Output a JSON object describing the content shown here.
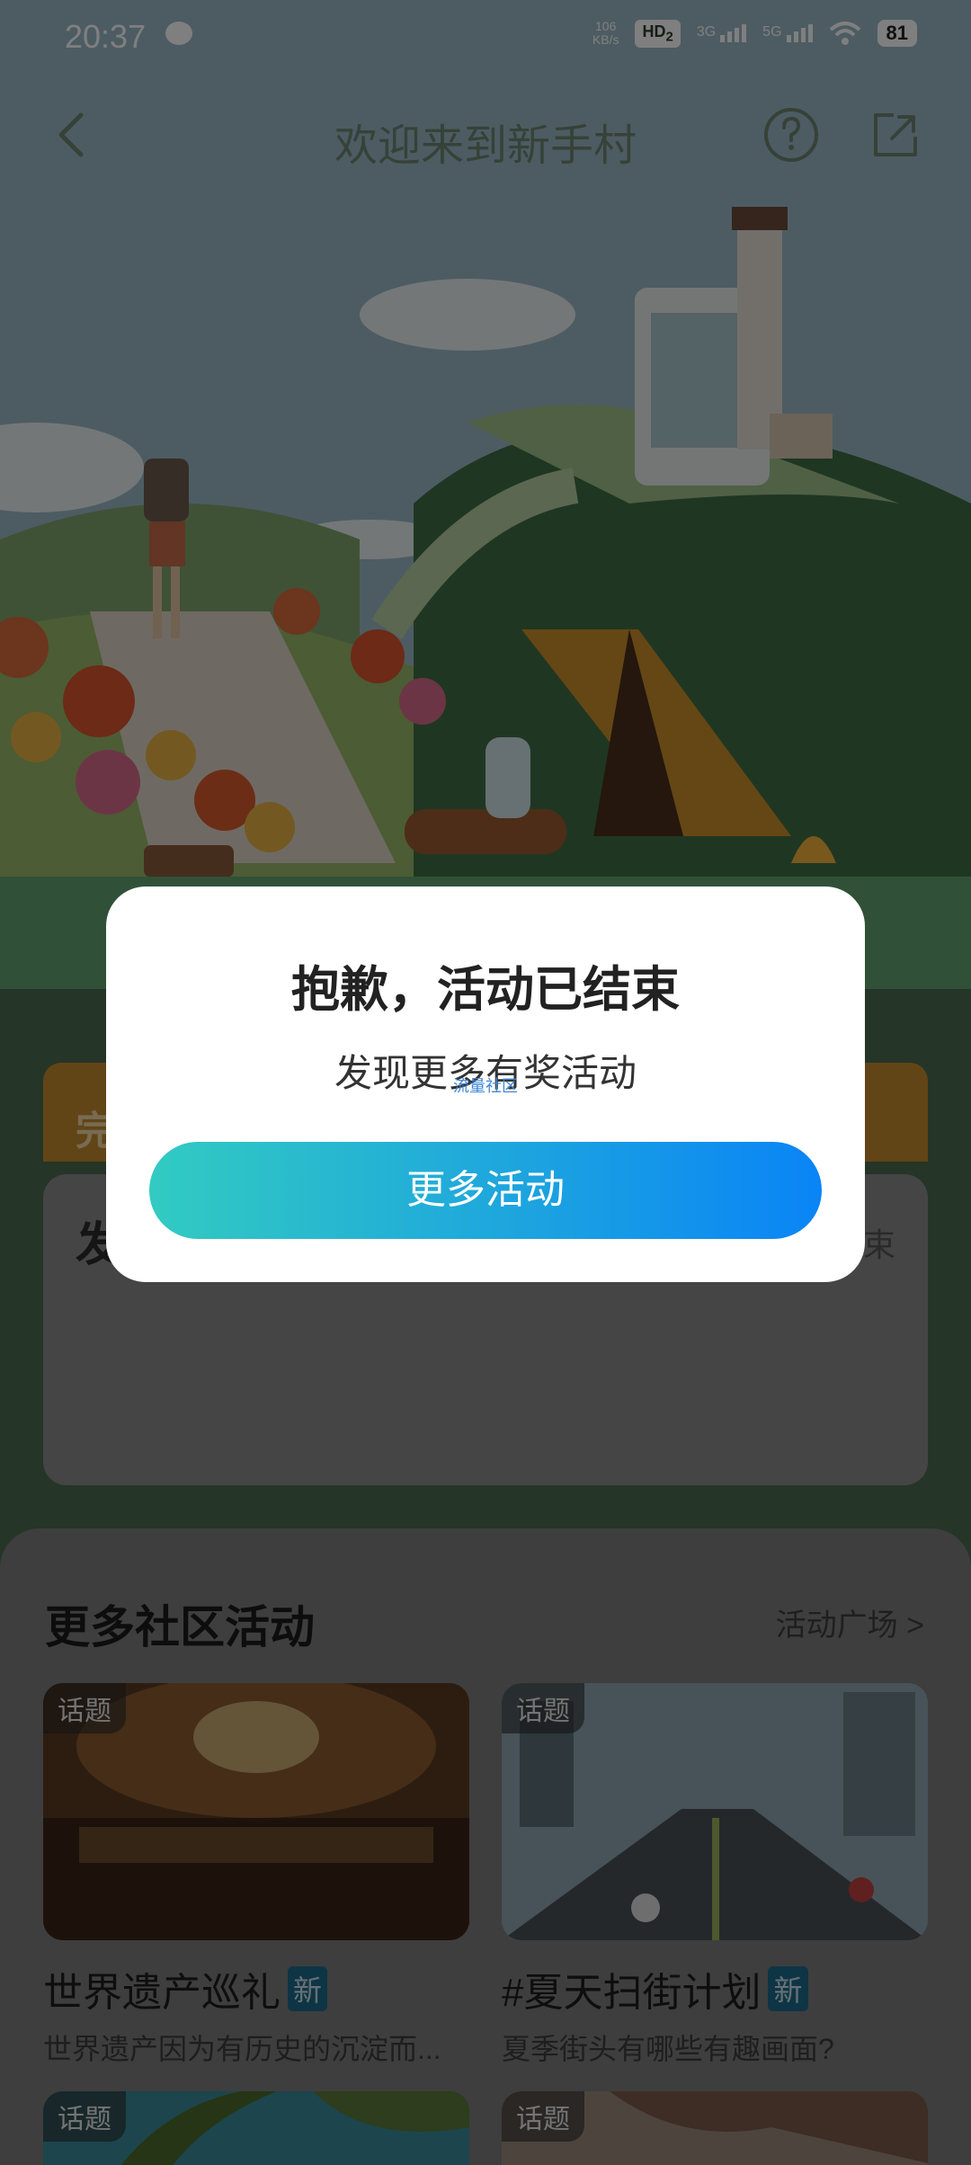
{
  "status_bar": {
    "time": "20:37",
    "net_speed_value": "106",
    "net_speed_unit": "KB/s",
    "hd_label": "HD",
    "hd_sub": "2",
    "sig1_label": "3G",
    "sig2_label": "5G",
    "battery": "81"
  },
  "nav": {
    "title": "欢迎来到新手村"
  },
  "task_card": {
    "tab_label": "完",
    "title": "发",
    "end_text": "束"
  },
  "sheet": {
    "title": "更多社区活动",
    "more_link": "活动广场 >",
    "cards": [
      {
        "tag": "话题",
        "title": "世界遗产巡礼",
        "badge": "新",
        "desc": "世界遗产因为有历史的沉淀而..."
      },
      {
        "tag": "话题",
        "title": "#夏天扫街计划",
        "badge": "新",
        "desc": "夏季街头有哪些有趣画面?"
      },
      {
        "tag": "话题"
      },
      {
        "tag": "话题"
      }
    ]
  },
  "dialog": {
    "title": "抱歉，活动已结束",
    "subtitle": "发现更多有奖活动",
    "watermark": "流量社区",
    "button": "更多活动"
  },
  "colors": {
    "accent_start": "#32cbc1",
    "accent_end": "#0a84f6"
  },
  "icons": [
    "chat-bubble-icon",
    "wifi-icon",
    "back-arrow-icon",
    "help-icon",
    "share-icon",
    "chevron-right-icon"
  ]
}
